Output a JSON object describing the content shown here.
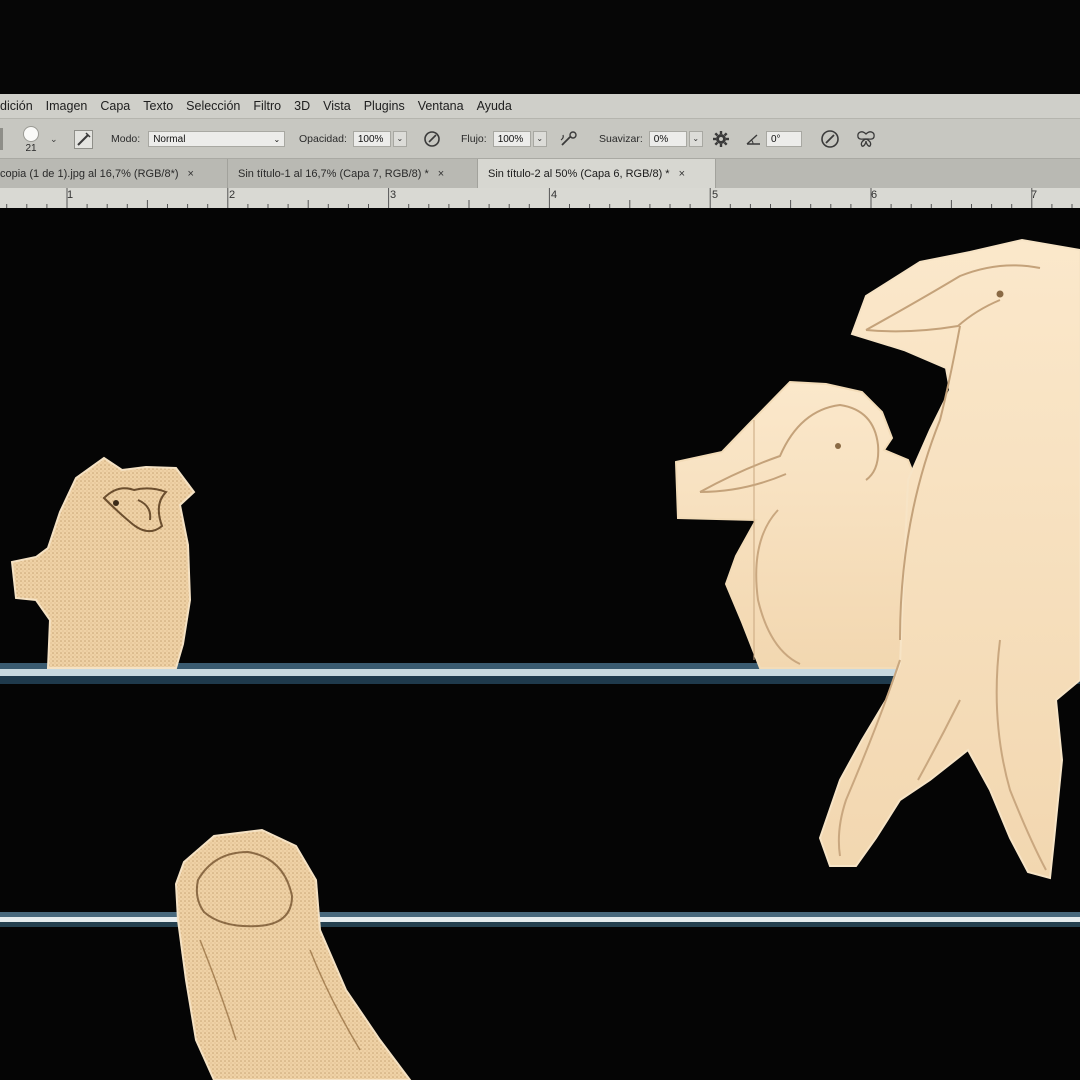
{
  "menu": [
    "dición",
    "Imagen",
    "Capa",
    "Texto",
    "Selección",
    "Filtro",
    "3D",
    "Vista",
    "Plugins",
    "Ventana",
    "Ayuda"
  ],
  "options": {
    "brush_size": "21",
    "mode_label": "Modo:",
    "mode_value": "Normal",
    "opacity_label": "Opacidad:",
    "opacity_value": "100%",
    "flow_label": "Flujo:",
    "flow_value": "100%",
    "smoothing_label": "Suavizar:",
    "smoothing_value": "0%",
    "angle_value": "0°"
  },
  "tabs": [
    {
      "label": "copia (1 de 1).jpg al 16,7% (RGB/8*)",
      "close": "×",
      "active": false
    },
    {
      "label": "Sin título-1 al 16,7% (Capa 7, RGB/8) *",
      "close": "×",
      "active": false
    },
    {
      "label": "Sin título-2 al 50% (Capa 6, RGB/8) *",
      "close": "×",
      "active": true
    }
  ],
  "ruler": [
    "1",
    "2",
    "3",
    "4",
    "5",
    "6",
    "7"
  ],
  "icons": [
    "brush-preset-icon",
    "brush-panel-icon",
    "airbrush-pressure-icon",
    "airbrush-icon",
    "settings-gear-icon",
    "angle-icon",
    "pressure-size-icon",
    "symmetry-butterfly-icon"
  ],
  "colors": {
    "canvas": "#050505",
    "paper": "#f7e1c0",
    "paper_shadow": "#e8c99a",
    "pencil": "#b89468",
    "wire": "#2c4a5c"
  }
}
